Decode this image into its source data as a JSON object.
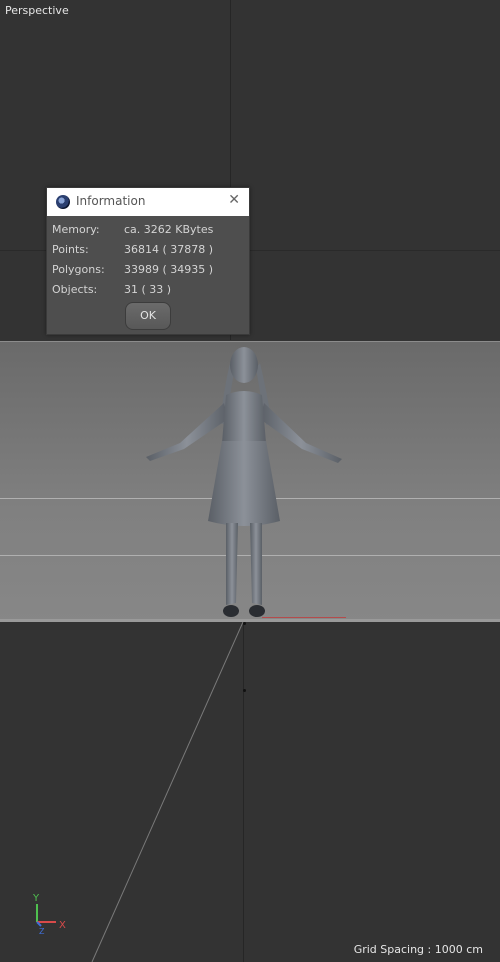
{
  "viewport": {
    "label": "Perspective",
    "grid_spacing": "Grid Spacing : 1000 cm"
  },
  "dialog": {
    "title": "Information",
    "icon": "cinema4d-logo-icon",
    "close_icon": "close-icon",
    "rows": [
      {
        "key": "Memory:",
        "value": "ca. 3262 KBytes"
      },
      {
        "key": "Points:",
        "value": "36814 ( 37878 )"
      },
      {
        "key": "Polygons:",
        "value": "33989 ( 34935 )"
      },
      {
        "key": "Objects:",
        "value": "31 ( 33 )"
      }
    ],
    "ok_label": "OK"
  },
  "axes": {
    "y": "Y",
    "z": "Z",
    "x": "X",
    "colors": {
      "y": "#4fc04f",
      "z": "#3f6fd8",
      "x": "#d84a4a"
    }
  }
}
